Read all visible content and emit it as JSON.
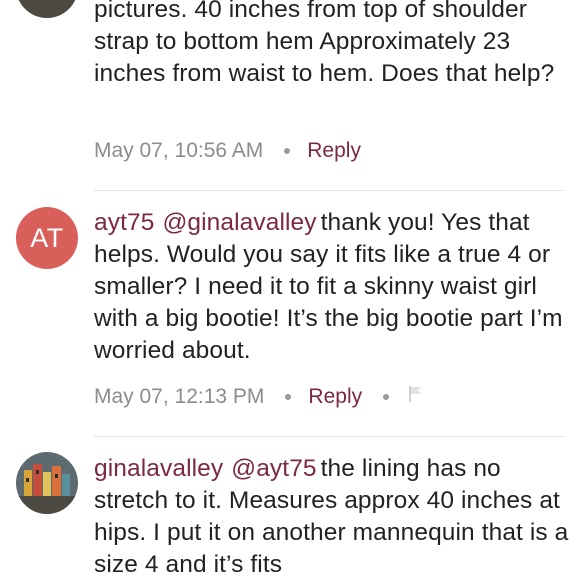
{
  "comments": [
    {
      "avatar": {
        "type": "photo",
        "icon": "colorful-houses-photo"
      },
      "text": "pictures. 40 inches from top of shoulder strap to bottom hem Approximately 23 inches from waist to hem. Does that help?",
      "timestamp": "May 07, 10:56 AM",
      "reply_label": "Reply"
    },
    {
      "avatar": {
        "type": "initials",
        "initials": "AT",
        "color": "#d9605a"
      },
      "username": "ayt75",
      "mention": "@ginalavalley",
      "text": "thank you! Yes that helps. Would you say it fits like a true 4 or smaller? I need it to fit a skinny waist girl with a big bootie! It’s the big bootie part I’m worried about.",
      "timestamp": "May 07, 12:13 PM",
      "reply_label": "Reply",
      "flag_icon": "flag-icon"
    },
    {
      "avatar": {
        "type": "photo",
        "icon": "colorful-houses-photo"
      },
      "username": "ginalavalley",
      "mention": "@ayt75",
      "text": "the lining has no stretch to it. Measures approx 40 inches at hips. I put it on another mannequin that is a size 4 and it’s fits"
    }
  ],
  "colors": {
    "accent": "#7c2940",
    "meta_text": "#8c8c8c",
    "divider": "#e4e4e4"
  }
}
